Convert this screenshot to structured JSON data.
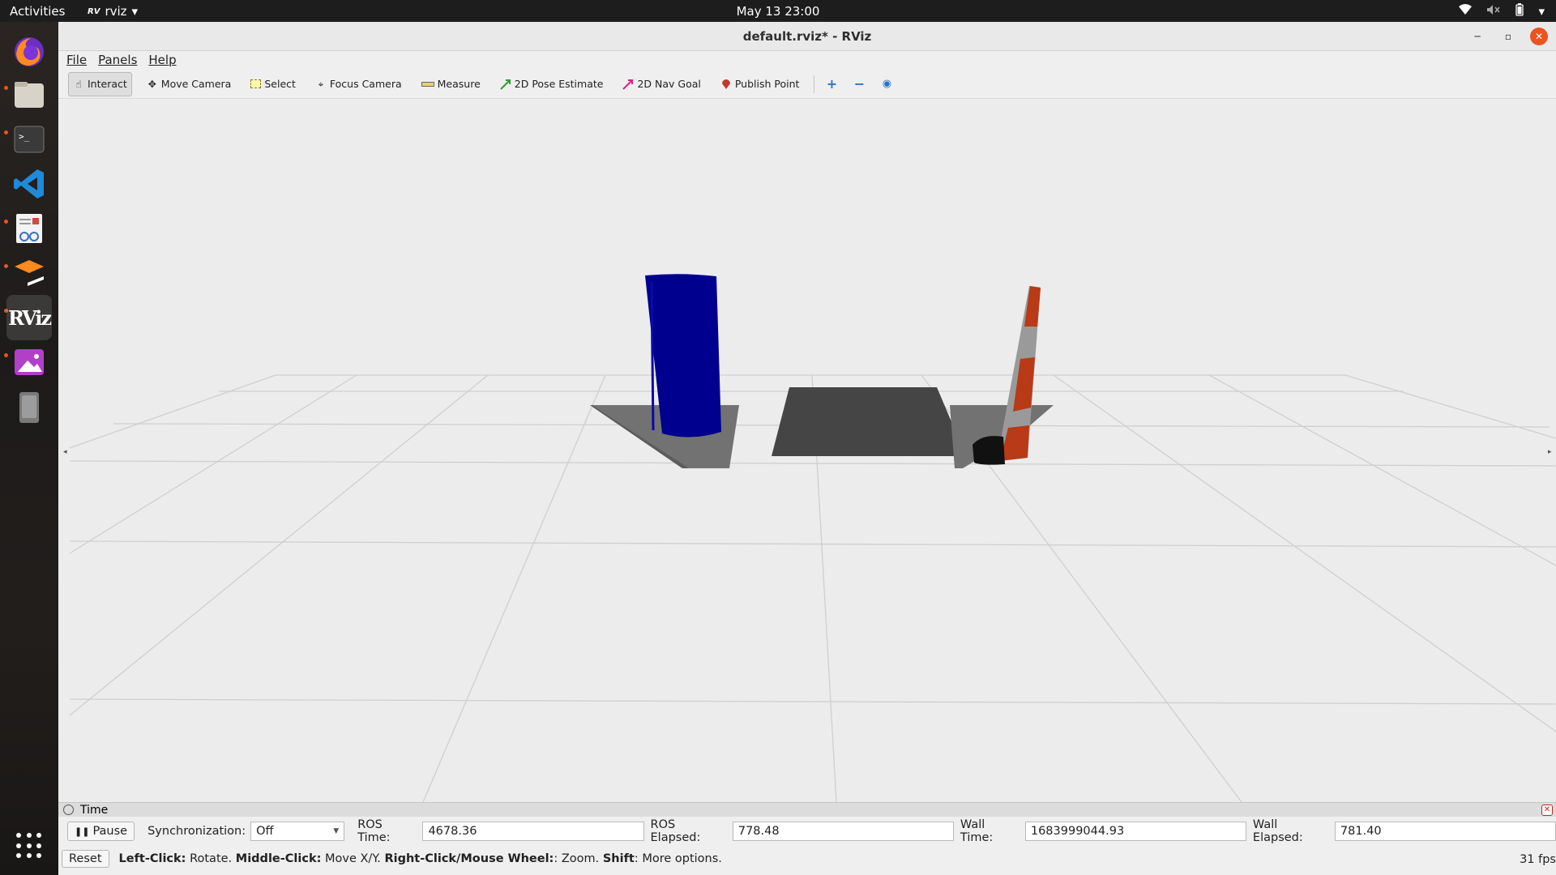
{
  "topbar": {
    "activities": "Activities",
    "app_name": "rviz",
    "clock": "May 13  23:00"
  },
  "dock": {
    "items": [
      "firefox-icon",
      "files-icon",
      "terminal-icon",
      "vscode-icon",
      "document-viewer-icon",
      "sublime-icon",
      "rviz-icon",
      "image-viewer-icon",
      "removable-drive-icon"
    ],
    "rviz_label": "RViz"
  },
  "window": {
    "title": "default.rviz* - RViz"
  },
  "menubar": {
    "file": "File",
    "panels": "Panels",
    "help": "Help"
  },
  "toolbar": {
    "interact": "Interact",
    "move_camera": "Move Camera",
    "select": "Select",
    "focus_camera": "Focus Camera",
    "measure": "Measure",
    "pose_estimate": "2D Pose Estimate",
    "nav_goal": "2D Nav Goal",
    "publish_point": "Publish Point"
  },
  "time_panel": {
    "title": "Time",
    "pause": "Pause",
    "sync_label": "Synchronization:",
    "sync_value": "Off",
    "ros_time_label": "ROS Time:",
    "ros_time": "4678.36",
    "ros_elapsed_label": "ROS Elapsed:",
    "ros_elapsed": "778.48",
    "wall_time_label": "Wall Time:",
    "wall_time": "1683999044.93",
    "wall_elapsed_label": "Wall Elapsed:",
    "wall_elapsed": "781.40"
  },
  "status": {
    "reset": "Reset",
    "left_click": "Left-Click:",
    "left_click_action": " Rotate. ",
    "middle_click": "Middle-Click:",
    "middle_click_action": " Move X/Y. ",
    "right_click": "Right-Click/Mouse Wheel:",
    "right_click_action": ": Zoom. ",
    "shift": "Shift",
    "shift_action": ": More options.",
    "fps": "31 fps"
  },
  "colors": {
    "accent": "#e95420",
    "cylinder": "#00008f",
    "cone_red": "#b83a16",
    "block": "#454545"
  }
}
